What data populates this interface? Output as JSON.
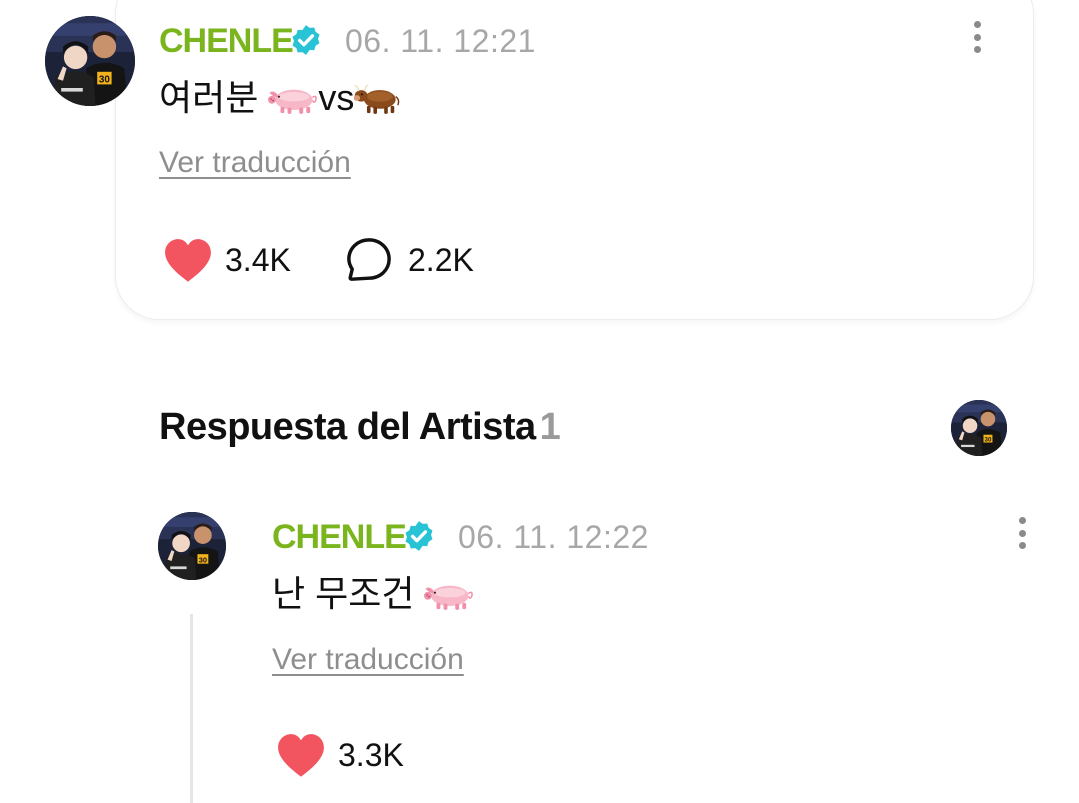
{
  "post": {
    "author": "CHENLE",
    "timestamp": "06. 11. 12:21",
    "text_prefix": "여러분 ",
    "text_middle": "vs",
    "translate_label": "Ver traducción",
    "likes": "3.4K",
    "comments": "2.2K",
    "emojis": [
      "pig-emoji",
      "ox-emoji"
    ]
  },
  "replies_section": {
    "title": "Respuesta del Artista",
    "count": "1"
  },
  "reply": {
    "author": "CHENLE",
    "timestamp": "06. 11. 12:22",
    "text": "난 무조건 ",
    "translate_label": "Ver traducción",
    "likes": "3.3K",
    "emojis": [
      "pig-emoji"
    ]
  },
  "colors": {
    "author_name": "#7ab51d",
    "verified_badge": "#29c3d6",
    "heart": "#f25560",
    "muted_text": "#a7a7a7"
  }
}
